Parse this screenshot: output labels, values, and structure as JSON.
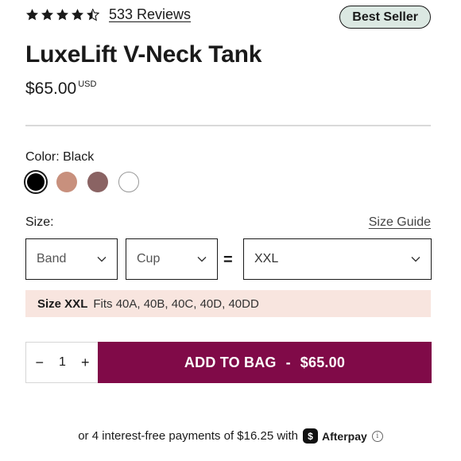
{
  "rating": {
    "stars": 4.5,
    "reviews_label": "533 Reviews"
  },
  "badge": "Best Seller",
  "product": {
    "title": "LuxeLift V-Neck Tank",
    "price": "$65.00",
    "currency": "USD"
  },
  "color": {
    "label": "Color: Black",
    "swatches": [
      {
        "name": "black",
        "hex": "#000000",
        "selected": true
      },
      {
        "name": "tan",
        "hex": "#c8907d"
      },
      {
        "name": "mauve",
        "hex": "#8a6363"
      },
      {
        "name": "white",
        "hex": "#ffffff"
      }
    ]
  },
  "size": {
    "label": "Size:",
    "guide_label": "Size Guide",
    "band_placeholder": "Band",
    "cup_placeholder": "Cup",
    "equals": "=",
    "result_value": "XXL",
    "fit_size": "Size XXL",
    "fit_text": "Fits 40A, 40B, 40C, 40D, 40DD"
  },
  "cart": {
    "decrement": "−",
    "quantity": "1",
    "increment": "+",
    "add_label": "ADD TO BAG",
    "separator": "-",
    "add_price": "$65.00"
  },
  "installments": {
    "text": "or 4 interest-free payments of $16.25 with",
    "provider": "Afterpay",
    "provider_glyph": "$",
    "info": "i"
  },
  "colors": {
    "accent": "#800a48",
    "badge_bg": "#dbe8e2",
    "fit_bg": "#f8e5df"
  }
}
